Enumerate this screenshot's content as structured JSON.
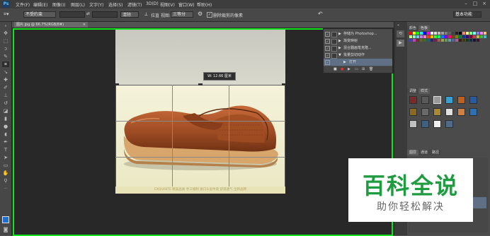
{
  "menubar": {
    "logo": "Ps",
    "items": [
      "文件(F)",
      "编辑(E)",
      "图像(I)",
      "图层(L)",
      "文字(Y)",
      "选择(S)",
      "滤镜(T)",
      "3D(D)",
      "视图(V)",
      "窗口(W)",
      "帮助(H)"
    ]
  },
  "options": {
    "ratio_select": "不受约束",
    "swap": "⇄",
    "clear_label": "清除",
    "straighten_label": "拉直",
    "view_label": "视图:",
    "view_select": "三等分",
    "delete_cropped_label": "删除裁剪的像素",
    "workspace_select": "基本功能"
  },
  "document": {
    "tab": "图片.jpg @ 66.7%(RGB/8#)",
    "size_tooltip": "W: 12.66 厘米",
    "caption": "EXQUISITE 精美品质 手工缝制 进口头层牛皮 舒适透气 全新品牌"
  },
  "actions": {
    "rows": [
      {
        "label": "存储为 Photoshop...",
        "checked": true
      },
      {
        "label": "渐变映射",
        "checked": true
      },
      {
        "label": "混合器画笔克隆...",
        "checked": true
      },
      {
        "label": "批量剪切动作",
        "checked": true
      },
      {
        "label": "打开",
        "checked": true
      }
    ]
  },
  "right": {
    "swatches_tabs": [
      "颜色",
      "色板"
    ],
    "styles_tabs": [
      "调整",
      "样式"
    ],
    "layers_tabs": [
      "图层",
      "通道",
      "路径"
    ],
    "swatch_colors": [
      "#ff0000",
      "#ffff00",
      "#00ff00",
      "#00ffff",
      "#0000ff",
      "#ff00ff",
      "#ffffff",
      "#e0e0e0",
      "#c0c0c0",
      "#a0a0a0",
      "#808080",
      "#606060",
      "#404040",
      "#202020",
      "#000000",
      "#ff8080",
      "#ffff80",
      "#80ff80",
      "#80ffff",
      "#8080ff",
      "#ff80ff",
      "#ffc080",
      "#c0ff80",
      "#80ffc0",
      "#80c0ff",
      "#c080ff",
      "#ff80c0",
      "#ff4000",
      "#ffc000",
      "#40ff00",
      "#00ff80",
      "#0080ff",
      "#8000ff",
      "#ff0080",
      "#804000",
      "#808000",
      "#008040",
      "#004080",
      "#400080",
      "#800040",
      "#c04040",
      "#c0c040",
      "#40c040",
      "#40c0c0",
      "#4040c0",
      "#c040c0",
      "#703020",
      "#706020",
      "#307030",
      "#206070",
      "#302070",
      "#702060",
      "#a06040",
      "#a0a060",
      "#60a060",
      "#60a0a0",
      "#6060a0",
      "#a060a0",
      "#3c1e10",
      "#3c3c10",
      "#103c1e",
      "#10303c",
      "#1e103c",
      "#3c1030"
    ]
  },
  "watermark": {
    "title": "百科全说",
    "subtitle": "助你轻松解决"
  }
}
